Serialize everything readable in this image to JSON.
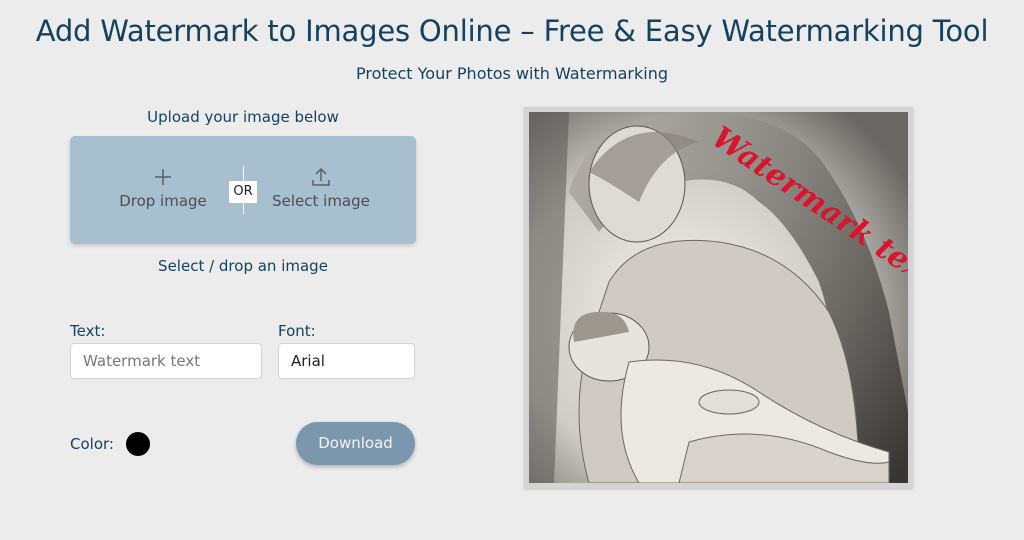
{
  "header": {
    "title": "Add Watermark to Images Online – Free & Easy Watermarking Tool",
    "subtitle": "Protect Your Photos with Watermarking"
  },
  "upload": {
    "hint": "Upload your image below",
    "drop_label": "Drop image",
    "or_label": "OR",
    "select_label": "Select image",
    "caption": "Select / drop an image",
    "drop_icon": "plus-icon",
    "select_icon": "upload-icon"
  },
  "form": {
    "text_label": "Text:",
    "text_placeholder": "Watermark text",
    "text_value": "",
    "font_label": "Font:",
    "font_value": "Arial",
    "color_label": "Color:",
    "color_value": "#000000",
    "download_label": "Download"
  },
  "preview": {
    "watermark_text": "Watermark text",
    "watermark_color": "#d9142b"
  },
  "colors": {
    "primary": "#15415f",
    "upload_zone": "#a8bfcf",
    "button": "#7b97ae",
    "background": "#ececec"
  }
}
